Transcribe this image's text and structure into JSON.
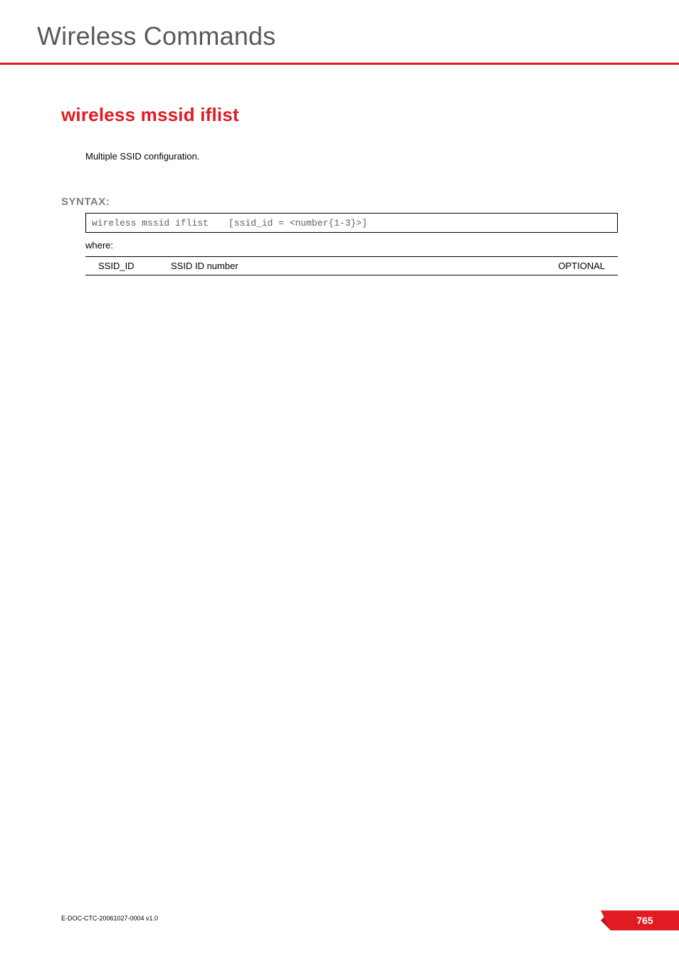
{
  "header": {
    "section_title": "Wireless Commands"
  },
  "command": {
    "title": "wireless mssid iflist",
    "description": "Multiple SSID configuration."
  },
  "syntax": {
    "label": "SYNTAX:",
    "command_text": "wireless mssid iflist",
    "argument_text": "[ssid_id = <number{1-3}>]",
    "where_label": "where:"
  },
  "params": [
    {
      "name": "SSID_ID",
      "description": "SSID ID number",
      "required": "OPTIONAL"
    }
  ],
  "footer": {
    "doc_ref": "E-DOC-CTC-20061027-0004 v1.0",
    "page_number": "765"
  }
}
